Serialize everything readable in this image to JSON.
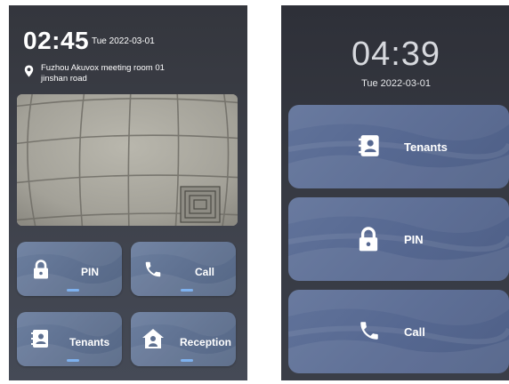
{
  "left_screen": {
    "time": "02:45",
    "date": "Tue 2022-03-01",
    "location_line1": "Fuzhou Akuvox meeting room 01",
    "location_line2": "jinshan road",
    "tiles": [
      {
        "label": "PIN",
        "icon": "lock-icon"
      },
      {
        "label": "Call",
        "icon": "phone-icon"
      },
      {
        "label": "Tenants",
        "icon": "contacts-icon"
      },
      {
        "label": "Reception",
        "icon": "home-person-icon"
      }
    ]
  },
  "right_screen": {
    "time": "04:39",
    "date": "Tue 2022-03-01",
    "buttons": [
      {
        "label": "Tenants",
        "icon": "contacts-icon"
      },
      {
        "label": "PIN",
        "icon": "lock-icon"
      },
      {
        "label": "Call",
        "icon": "phone-icon"
      }
    ]
  },
  "colors": {
    "tile_blue": "#5e7090",
    "indicator_blue": "#7db1ef",
    "screen_dark": "#34363d"
  }
}
